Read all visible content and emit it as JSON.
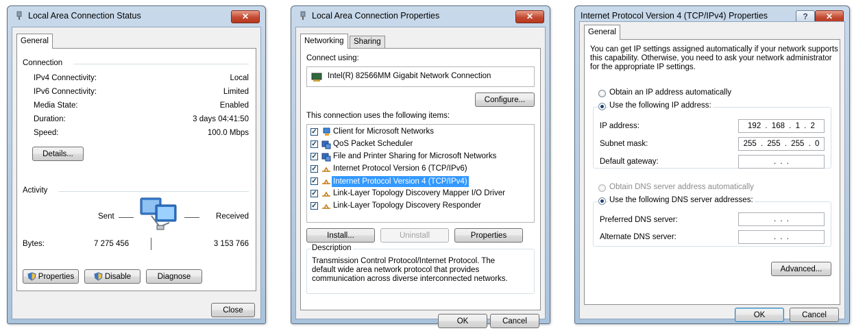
{
  "status_window": {
    "title": "Local Area Connection Status",
    "tab": "General",
    "connection_heading": "Connection",
    "fields": [
      {
        "label": "IPv4 Connectivity:",
        "value": "Local"
      },
      {
        "label": "IPv6 Connectivity:",
        "value": "Limited"
      },
      {
        "label": "Media State:",
        "value": "Enabled"
      },
      {
        "label": "Duration:",
        "value": "3 days 04:41:50"
      },
      {
        "label": "Speed:",
        "value": "100.0 Mbps"
      }
    ],
    "details_button": "Details...",
    "activity_heading": "Activity",
    "sent_label": "Sent",
    "received_label": "Received",
    "bytes_label": "Bytes:",
    "bytes_sent": "7 275 456",
    "bytes_received": "3 153 766",
    "properties_button": "Properties",
    "disable_button": "Disable",
    "diagnose_button": "Diagnose",
    "close_button": "Close"
  },
  "properties_window": {
    "title": "Local Area Connection Properties",
    "tabs": [
      "Networking",
      "Sharing"
    ],
    "connect_using_label": "Connect using:",
    "adapter_name": "Intel(R) 82566MM Gigabit Network Connection",
    "configure_button": "Configure...",
    "items_label": "This connection uses the following items:",
    "items": [
      {
        "label": "Client for Microsoft Networks",
        "checked": true,
        "icon": "network-client-icon"
      },
      {
        "label": "QoS Packet Scheduler",
        "checked": true,
        "icon": "qos-scheduler-icon"
      },
      {
        "label": "File and Printer Sharing for Microsoft Networks",
        "checked": true,
        "icon": "file-printer-sharing-icon"
      },
      {
        "label": "Internet Protocol Version 6 (TCP/IPv6)",
        "checked": true,
        "icon": "protocol-icon"
      },
      {
        "label": "Internet Protocol Version 4 (TCP/IPv4)",
        "checked": true,
        "icon": "protocol-icon",
        "selected": true
      },
      {
        "label": "Link-Layer Topology Discovery Mapper I/O Driver",
        "checked": true,
        "icon": "protocol-icon"
      },
      {
        "label": "Link-Layer Topology Discovery Responder",
        "checked": true,
        "icon": "protocol-icon"
      }
    ],
    "install_button": "Install...",
    "uninstall_button": "Uninstall",
    "properties_button": "Properties",
    "description_heading": "Description",
    "description_text": "Transmission Control Protocol/Internet Protocol. The default wide area network protocol that provides communication across diverse interconnected networks.",
    "ok_button": "OK",
    "cancel_button": "Cancel"
  },
  "ipv4_window": {
    "title": "Internet Protocol Version 4 (TCP/IPv4) Properties",
    "tab": "General",
    "intro_text": "You can get IP settings assigned automatically if your network supports this capability. Otherwise, you need to ask your network administrator for the appropriate IP settings.",
    "obtain_ip_auto": "Obtain an IP address automatically",
    "use_following_ip": "Use the following IP address:",
    "ip_address_label": "IP address:",
    "ip_address_value": "192 . 168 . 1 . 2",
    "subnet_mask_label": "Subnet mask:",
    "subnet_mask_value": "255 . 255 . 255 . 0",
    "default_gateway_label": "Default gateway:",
    "empty_ip_value": ".   .   .",
    "obtain_dns_auto": "Obtain DNS server address automatically",
    "use_following_dns": "Use the following DNS server addresses:",
    "preferred_dns_label": "Preferred DNS server:",
    "alternate_dns_label": "Alternate DNS server:",
    "advanced_button": "Advanced...",
    "ok_button": "OK",
    "cancel_button": "Cancel",
    "help_button": "?"
  },
  "colors": {
    "selection": "#3399ff",
    "title_bar": "#b9cfe6",
    "close_button": "#c34a32"
  }
}
